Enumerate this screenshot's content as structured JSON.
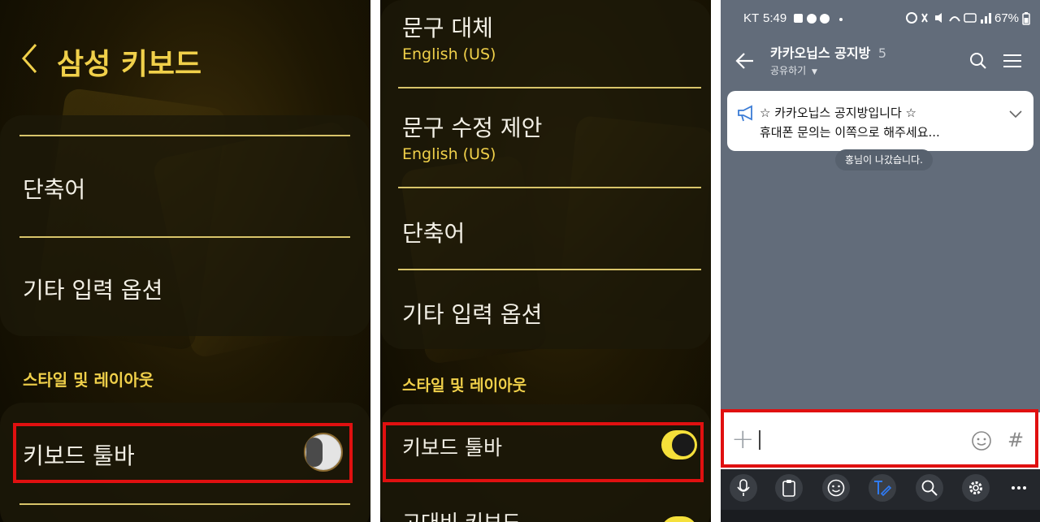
{
  "left_panel": {
    "title": "삼성 키보드",
    "items": [
      {
        "label": "단축어"
      },
      {
        "label": "기타 입력 옵션"
      }
    ],
    "section_header": "스타일 및 레이아웃",
    "toolbar_item": {
      "label": "키보드 툴바",
      "enabled": false
    }
  },
  "middle_panel": {
    "items": [
      {
        "label": "문구 대체",
        "sub": "English (US)"
      },
      {
        "label": "문구 수정 제안",
        "sub": "English (US)"
      },
      {
        "label": "단축어"
      },
      {
        "label": "기타 입력 옵션"
      }
    ],
    "section_header": "스타일 및 레이아웃",
    "toolbar_item": {
      "label": "키보드 툴바",
      "enabled": true
    },
    "cut_item": {
      "label": "고대비 키보드"
    }
  },
  "right_panel": {
    "status": {
      "carrier": "KT",
      "time": "5:49",
      "battery": "67%"
    },
    "header": {
      "room_name": "카카오닙스 공지방",
      "member_count": "5",
      "share_label": "공유하기"
    },
    "notice": {
      "line1": "☆ 카카오닙스 공지방입니다 ☆",
      "line2": "휴대폰 문의는 이쪽으로 해주세요..."
    },
    "system_message": "홍님이 나갔습니다.",
    "input": {
      "plus": "+",
      "hash": "#"
    }
  },
  "colors": {
    "accent_gold": "#f0d04a",
    "highlight_red": "#e01010",
    "chat_bg": "#626c7a",
    "toggle_on": "#f5e03a",
    "format_icon_blue": "#2f7bf6"
  }
}
